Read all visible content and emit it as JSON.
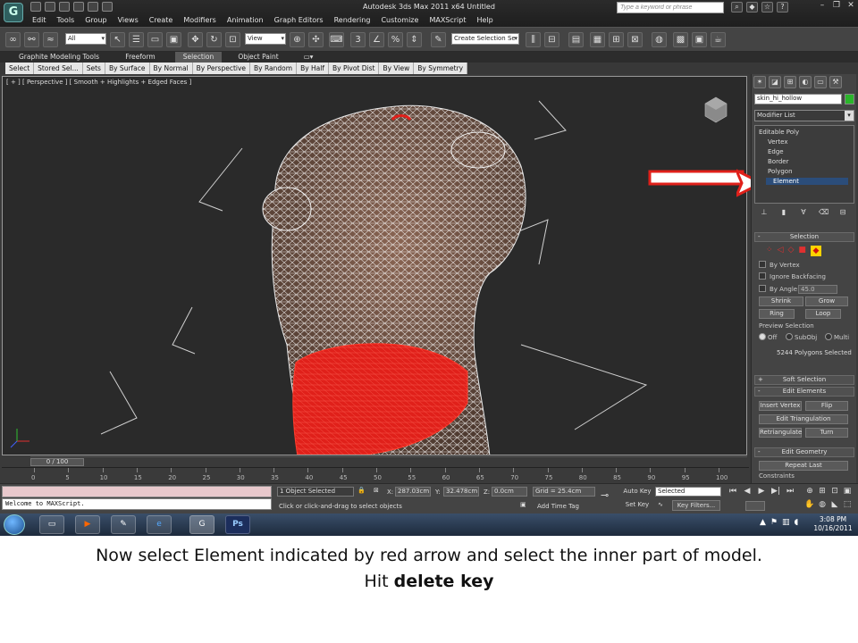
{
  "window": {
    "title": "Autodesk 3ds Max  2011 x64     Untitled",
    "search_placeholder": "Type a keyword or phrase",
    "logo_letter": "G"
  },
  "menu": [
    "Edit",
    "Tools",
    "Group",
    "Views",
    "Create",
    "Modifiers",
    "Animation",
    "Graph Editors",
    "Rendering",
    "Customize",
    "MAXScript",
    "Help"
  ],
  "toolbar": {
    "selection_filter": "All",
    "ref_coord": "View",
    "named_selection": "Create Selection Se"
  },
  "ribbon": {
    "tabs": [
      "Graphite Modeling Tools",
      "Freeform",
      "Selection",
      "Object Paint"
    ],
    "active_tab": "Selection",
    "items": [
      "Select",
      "Stored Sel...",
      "Sets",
      "By Surface",
      "By Normal",
      "By Perspective",
      "By Random",
      "By Half",
      "By Pivot Dist",
      "By View",
      "By Symmetry"
    ]
  },
  "viewport": {
    "label": "[ + ] [ Perspective ] [ Smooth + Highlights + Edged Faces ]"
  },
  "command_panel": {
    "object_name": "skin_hi_hollow",
    "modifier_list": "Modifier List",
    "stack": {
      "root": "Editable Poly",
      "items": [
        "Vertex",
        "Edge",
        "Border",
        "Polygon",
        "Element"
      ],
      "selected": "Element"
    },
    "selection_rollout": {
      "title": "Selection",
      "by_vertex": "By Vertex",
      "ignore_backfacing": "Ignore Backfacing",
      "by_angle": "By Angle:",
      "angle_value": "45.0",
      "shrink": "Shrink",
      "grow": "Grow",
      "ring": "Ring",
      "loop": "Loop",
      "preview_label": "Preview Selection",
      "preview_off": "Off",
      "preview_subobj": "SubObj",
      "preview_multi": "Multi",
      "status": "5244 Polygons Selected"
    },
    "soft_selection": "Soft Selection",
    "edit_elements": {
      "title": "Edit Elements",
      "insert_vertex": "Insert Vertex",
      "flip": "Flip",
      "edit_triangulation": "Edit Triangulation",
      "retriangulate": "Retriangulate",
      "turn": "Turn"
    },
    "edit_geometry": {
      "title": "Edit Geometry",
      "repeat_last": "Repeat Last",
      "constraints": "Constraints"
    }
  },
  "time_slider": {
    "frame_label": "0 / 100"
  },
  "track_ticks": [
    "0",
    "5",
    "10",
    "15",
    "20",
    "25",
    "30",
    "35",
    "40",
    "45",
    "50",
    "55",
    "60",
    "65",
    "70",
    "75",
    "80",
    "85",
    "90",
    "95",
    "100"
  ],
  "status": {
    "listener_text": "Welcome to MAXScript.",
    "selected_count": "1 Object Selected",
    "prompt": "Click or click-and-drag to select objects",
    "x_label": "X:",
    "x_value": "287.03cm",
    "y_label": "Y:",
    "y_value": "32.478cm",
    "z_label": "Z:",
    "z_value": "0.0cm",
    "grid": "Grid = 25.4cm",
    "add_time_tag": "Add Time Tag",
    "auto_key": "Auto Key",
    "set_key": "Set Key",
    "key_mode": "Selected",
    "key_filters": "Key Filters..."
  },
  "taskbar": {
    "time": "3:08 PM",
    "date": "10/16/2011",
    "apps": [
      "explorer-icon",
      "media-player-icon",
      "wacom-icon",
      "ie-icon",
      "3dsmax-icon",
      "photoshop-icon"
    ],
    "ps_label": "Ps"
  },
  "caption": {
    "line1": "Now select Element indicated by red arrow and select the inner part of model.",
    "line2_prefix": "Hit ",
    "line2_bold": "delete key"
  },
  "colors": {
    "selection_red": "#e0201a",
    "annotation_arrow": "#e0201a",
    "object_color": "#2ab52a",
    "stack_highlight": "#2b4d7a"
  }
}
